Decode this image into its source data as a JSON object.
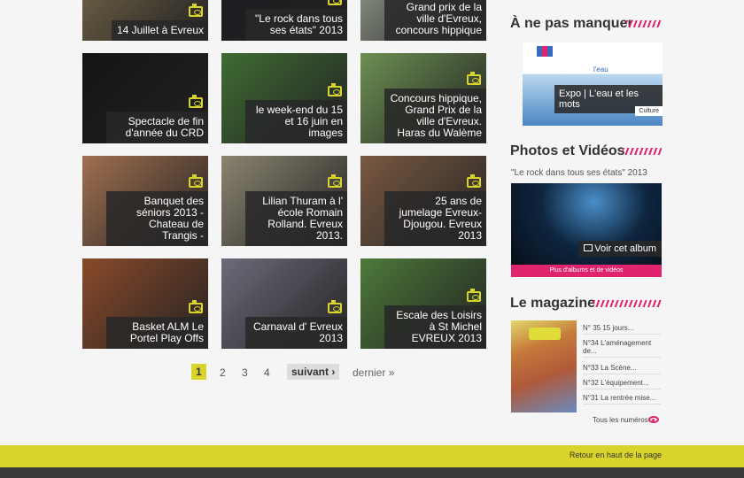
{
  "gallery": [
    {
      "caption": "14 Juillet à Evreux",
      "bg": "#7a6a4c"
    },
    {
      "caption": "\"Le rock dans tous ses états\" 2013",
      "bg": "#1c1c22"
    },
    {
      "caption": "Grand prix de la ville d'Evreux, concours hippique",
      "bg": "#9aa294"
    },
    {
      "caption": "Spectacle de fin d'année du CRD",
      "bg": "#141414"
    },
    {
      "caption": "le week-end du 15 et 16 juin en images",
      "bg": "#3f6b33"
    },
    {
      "caption": "Concours hippique, Grand Prix de la ville d'Evreux. Haras du Walème",
      "bg": "#6c8f52"
    },
    {
      "caption": "Banquet des séniors 2013 - Chateau de Trangis -",
      "bg": "#a07050"
    },
    {
      "caption": "Lilian Thuram à l' école Romain Rolland. Evreux 2013.",
      "bg": "#8a8470"
    },
    {
      "caption": "25 ans de jumelage Evreux-Djougou. Evreux 2013",
      "bg": "#7a5a42"
    },
    {
      "caption": "Basket ALM Le Portel Play Offs",
      "bg": "#8a4a2a"
    },
    {
      "caption": "Carnaval d' Evreux 2013",
      "bg": "#6f6a7a"
    },
    {
      "caption": "Escale des Loisirs à St Michel EVREUX 2013",
      "bg": "#4d7a3a"
    }
  ],
  "pagination": {
    "current": "1",
    "pages": [
      "2",
      "3",
      "4"
    ],
    "next": "suivant ›",
    "last": "dernier »"
  },
  "sidebar": {
    "not_to_miss": {
      "title": "À ne pas manquer",
      "logo_text": "l'eau",
      "card_label": "Expo | L'eau et les mots",
      "tag": "Culture"
    },
    "media": {
      "title": "Photos et Vidéos",
      "album_title": "\"Le rock dans tous ses états\" 2013",
      "view_album": "Voir cet album",
      "more": "Plus d'albums et de vidéos"
    },
    "magazine": {
      "title": "Le magazine",
      "items": [
        "N° 35 15 jours...",
        "N°34 L'aménagement de...",
        "N°33 La Scène...",
        "N°32 L'équipement...",
        "N°31 La rentrée mise..."
      ],
      "all": "Tous les numéros"
    }
  },
  "footer": {
    "back_to_top": "Retour en haut de la page"
  },
  "colors": {
    "accent": "#d8d42c",
    "pink": "#e0246e"
  }
}
